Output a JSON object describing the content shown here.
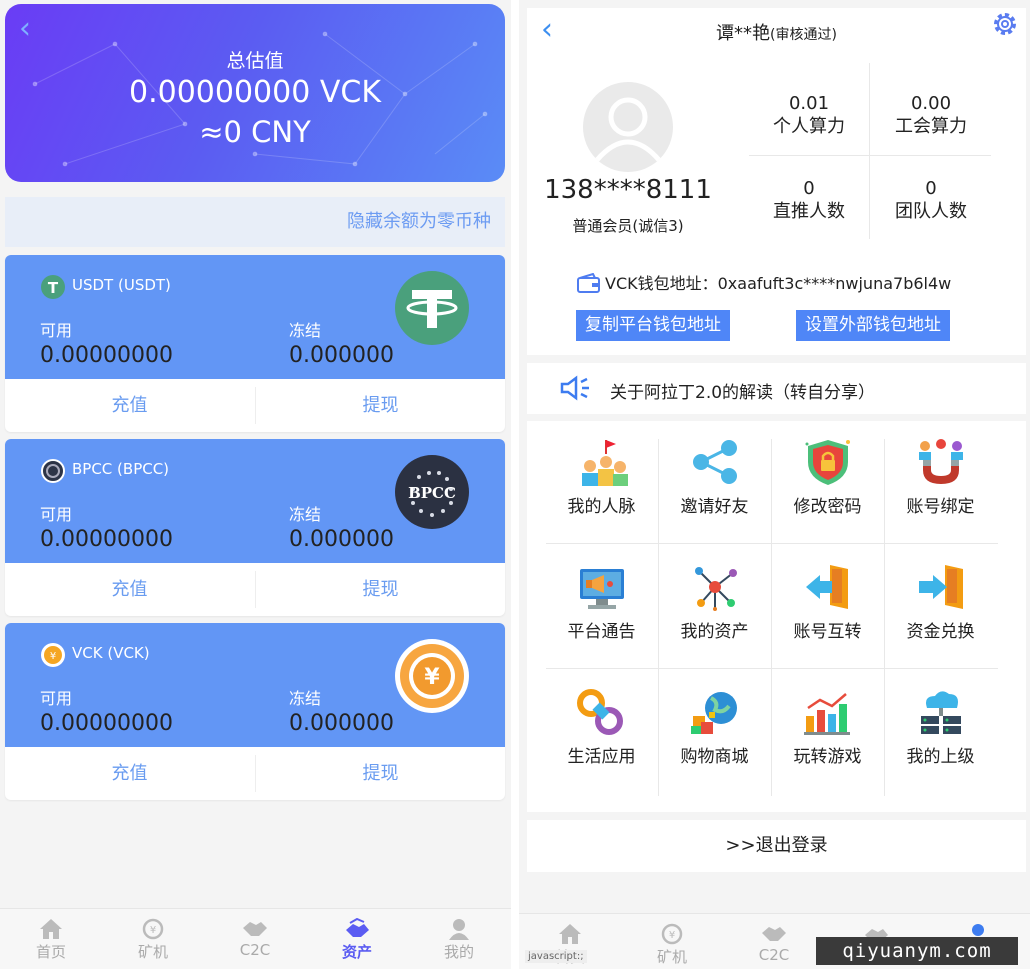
{
  "assets": {
    "header": {
      "title": "总估值",
      "amount": "0.00000000 VCK",
      "cny": "≈0 CNY"
    },
    "hide_zero": "隐藏余额为零币种",
    "coins": [
      {
        "name": "USDT (USDT)",
        "available_label": "可用",
        "available": "0.00000000",
        "frozen_label": "冻结",
        "frozen": "0.000000",
        "deposit": "充值",
        "withdraw": "提现"
      },
      {
        "name": "BPCC (BPCC)",
        "available_label": "可用",
        "available": "0.00000000",
        "frozen_label": "冻结",
        "frozen": "0.000000",
        "deposit": "充值",
        "withdraw": "提现"
      },
      {
        "name": "VCK (VCK)",
        "available_label": "可用",
        "available": "0.00000000",
        "frozen_label": "冻结",
        "frozen": "0.000000",
        "deposit": "充值",
        "withdraw": "提现"
      }
    ],
    "bpcc_logo_text": "BPCC",
    "vck_logo_text": "¥"
  },
  "tabs": [
    {
      "label": "首页",
      "icon": "home-icon"
    },
    {
      "label": "矿机",
      "icon": "miner-icon"
    },
    {
      "label": "C2C",
      "icon": "handshake-icon"
    },
    {
      "label": "资产",
      "icon": "assets-icon"
    },
    {
      "label": "我的",
      "icon": "user-icon"
    }
  ],
  "profile": {
    "name": "谭**艳",
    "status": "(审核通过)",
    "phone": "138****8111",
    "level": "普通会员(诚信3)",
    "stats": [
      {
        "value": "0.01",
        "label": "个人算力"
      },
      {
        "value": "0.00",
        "label": "工会算力"
      },
      {
        "value": "0",
        "label": "直推人数"
      },
      {
        "value": "0",
        "label": "团队人数"
      }
    ],
    "wallet_label": "VCK钱包地址：",
    "wallet_address": "0xaafuft3c****nwjuna7b6l4w",
    "copy_button": "复制平台钱包地址",
    "set_button": "设置外部钱包地址",
    "notice": "关于阿拉丁2.0的解读（转自分享）",
    "menu": [
      {
        "label": "我的人脉",
        "icon": "network-icon"
      },
      {
        "label": "邀请好友",
        "icon": "share-icon"
      },
      {
        "label": "修改密码",
        "icon": "shield-lock-icon"
      },
      {
        "label": "账号绑定",
        "icon": "magnet-icon"
      },
      {
        "label": "平台通告",
        "icon": "megaphone-icon"
      },
      {
        "label": "我的资产",
        "icon": "molecule-icon"
      },
      {
        "label": "账号互转",
        "icon": "transfer-in-icon"
      },
      {
        "label": "资金兑换",
        "icon": "exchange-icon"
      },
      {
        "label": "生活应用",
        "icon": "link-icon"
      },
      {
        "label": "购物商城",
        "icon": "globe-icon"
      },
      {
        "label": "玩转游戏",
        "icon": "bar-chart-icon"
      },
      {
        "label": "我的上级",
        "icon": "cloud-server-icon"
      }
    ],
    "logout": ">>退出登录"
  },
  "status_text": "javascript:;",
  "watermark": "qiyuanym.com",
  "colors": {
    "accent": "#5b5cf2",
    "card_blue": "#6296f5",
    "link_blue": "#6a9cf0",
    "button_blue": "#4f86f7"
  }
}
